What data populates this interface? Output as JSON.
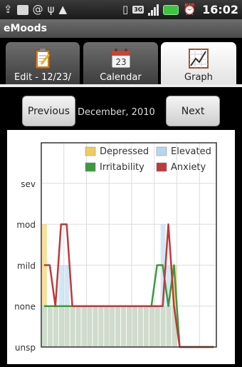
{
  "status_bar": {
    "icons": [
      "usb-icon",
      "message-icon",
      "at-sign-icon",
      "usb-debug-icon",
      "warning-icon",
      "vibrate-icon",
      "signal-3g-icon",
      "wifi-icon",
      "battery-icon",
      "alarm-icon"
    ],
    "network_type": "3G",
    "time": "16:02"
  },
  "app": {
    "title": "eMoods"
  },
  "tabs": [
    {
      "label": "Edit - 12/23/",
      "icon": "clipboard-edit-icon",
      "selected": false
    },
    {
      "label": "Calendar",
      "icon": "calendar-icon",
      "selected": false,
      "icon_text": "23"
    },
    {
      "label": "Graph",
      "icon": "graph-icon",
      "selected": true
    }
  ],
  "nav": {
    "previous_label": "Previous",
    "month_label": "December, 2010",
    "next_label": "Next"
  },
  "colors": {
    "depressed": "#f0cc5a",
    "elevated": "#b4d7ee",
    "irritability": "#3c9a3c",
    "anxiety": "#c0383a",
    "tab_active": "#ffffff",
    "tab_inactive": "#5a5a5a"
  },
  "chart_data": {
    "type": "area",
    "ylabels": [
      "sev",
      "mod",
      "mild",
      "none",
      "unsp"
    ],
    "x": [
      1,
      2,
      3,
      4,
      5,
      6,
      7,
      8,
      9,
      10,
      11,
      12,
      13,
      14,
      15,
      16,
      17,
      18,
      19,
      20,
      21,
      22,
      23,
      24,
      25,
      26,
      27,
      28,
      29,
      30,
      31
    ],
    "series": [
      {
        "name": "Depressed",
        "kind": "bar",
        "values": [
          3,
          1,
          1,
          1,
          1,
          1,
          1,
          1,
          1,
          1,
          1,
          1,
          1,
          1,
          1,
          1,
          1,
          1,
          1,
          1,
          1,
          1,
          1,
          2,
          0,
          0,
          0,
          0,
          0,
          0,
          0
        ]
      },
      {
        "name": "Elevated",
        "kind": "bar",
        "values": [
          1,
          1,
          1,
          2,
          2,
          1,
          1,
          1,
          1,
          1,
          1,
          1,
          1,
          1,
          1,
          1,
          1,
          1,
          1,
          1,
          1,
          3,
          2,
          1,
          0,
          0,
          0,
          0,
          0,
          0,
          0
        ]
      },
      {
        "name": "Irritability",
        "kind": "line",
        "values": [
          1,
          1,
          1,
          1,
          1,
          1,
          1,
          1,
          1,
          1,
          1,
          1,
          1,
          1,
          1,
          1,
          1,
          1,
          1,
          1,
          2,
          2,
          1,
          2,
          0,
          0,
          0,
          0,
          0,
          0,
          0
        ]
      },
      {
        "name": "Anxiety",
        "kind": "line",
        "values": [
          2,
          2,
          1,
          3,
          3,
          1,
          1,
          1,
          1,
          1,
          1,
          1,
          1,
          1,
          1,
          1,
          1,
          1,
          1,
          1,
          1,
          1,
          3,
          1,
          0,
          0,
          0,
          0,
          0,
          0,
          0
        ]
      }
    ],
    "ylim": [
      0,
      4
    ],
    "grid": true,
    "legend": "top-right"
  }
}
